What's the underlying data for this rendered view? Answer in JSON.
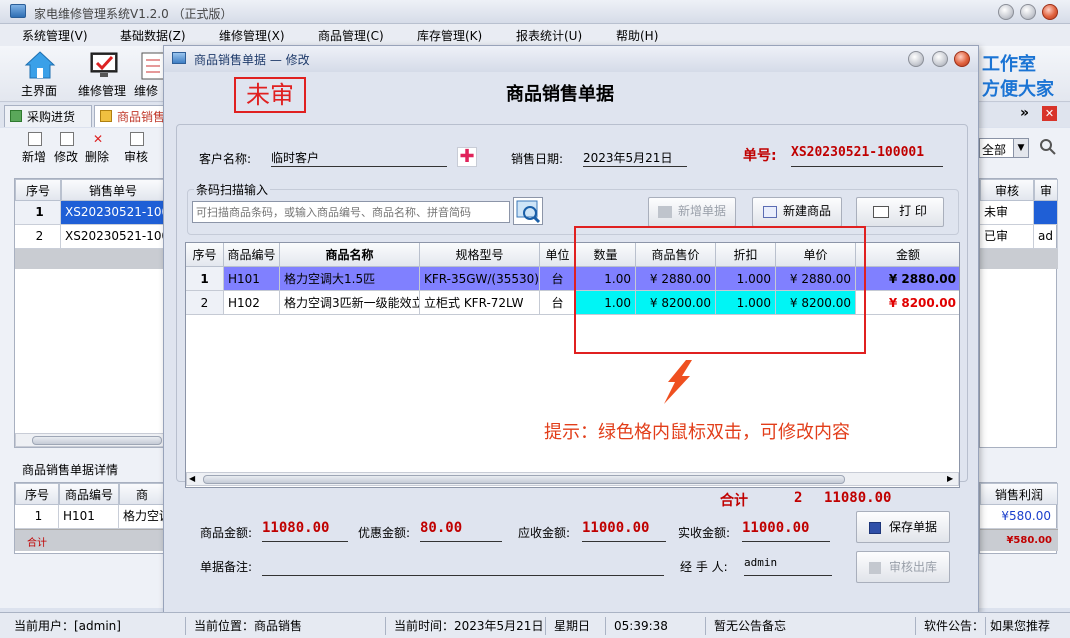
{
  "app": {
    "title": "家电维修管理系统V1.2.0 （正式版）"
  },
  "menu": [
    "系统管理(V)",
    "基础数据(Z)",
    "维修管理(X)",
    "商品管理(C)",
    "库存管理(K)",
    "报表统计(U)",
    "帮助(H)"
  ],
  "toolbar": {
    "home": "主界面",
    "repair": "维修管理",
    "repair2": "维修"
  },
  "banner": {
    "line1": "工作室",
    "line2": "方便大家"
  },
  "tabs": [
    {
      "label": "采购进货"
    },
    {
      "label": "商品销售"
    }
  ],
  "subtoolbar": {
    "add": "新增",
    "edit": "修改",
    "delete": "删除",
    "audit": "审核"
  },
  "right_filter": {
    "value": "全部"
  },
  "left_list": {
    "headers": [
      "序号",
      "销售单号"
    ],
    "rows": [
      {
        "no": "1",
        "id": "XS20230521-1000"
      },
      {
        "no": "2",
        "id": "XS20230521-1000"
      }
    ]
  },
  "right_cols": {
    "headers": [
      "审核",
      "审"
    ],
    "rows": [
      [
        "未审",
        ""
      ],
      [
        "已审",
        "ad"
      ]
    ]
  },
  "detail_panel": {
    "title": "商品销售单据详情",
    "headers": [
      "序号",
      "商品编号",
      "商"
    ],
    "rows": [
      {
        "no": "1",
        "code": "H101",
        "name": "格力空调"
      }
    ],
    "total_label": "合计",
    "profit_header": "销售利润",
    "profit_values": [
      "¥580.00"
    ],
    "profit_total": "¥580.00"
  },
  "dialog": {
    "title": "商品销售单据 — 修改",
    "stamp": "未审",
    "heading": "商品销售单据",
    "customer_label": "客户名称:",
    "customer_value": "临时客户",
    "date_label": "销售日期:",
    "date_value": "2023年5月21日",
    "order_label": "单号:",
    "order_no": "XS20230521-100001",
    "scan_group": "条码扫描输入",
    "scan_placeholder": "可扫描商品条码，或输入商品编号、商品名称、拼音简码",
    "btn_new_order": "新增单据",
    "btn_new_product": "新建商品",
    "btn_print": "打 印",
    "grid": {
      "headers": [
        "序号",
        "商品编号",
        "商品名称",
        "规格型号",
        "单位",
        "数量",
        "商品售价",
        "折扣",
        "单价",
        "金额"
      ],
      "rows": [
        [
          "1",
          "H101",
          "格力空调大1.5匹",
          "KFR-35GW/(35530)",
          "台",
          "1.00",
          "¥ 2880.00",
          "1.000",
          "¥ 2880.00",
          "¥ 2880.00"
        ],
        [
          "2",
          "H102",
          "格力空调3匹新一级能效立",
          "立柜式 KFR-72LW",
          "台",
          "1.00",
          "¥ 8200.00",
          "1.000",
          "¥ 8200.00",
          "¥ 8200.00"
        ]
      ]
    },
    "hint": "提示：绿色格内鼠标双击，可修改内容",
    "total_label": "合计",
    "total_count": "2",
    "total_amount": "11080.00",
    "goods_amount_label": "商品金额:",
    "goods_amount": "11080.00",
    "discount_label": "优惠金额:",
    "discount": "80.00",
    "receivable_label": "应收金额:",
    "receivable": "11000.00",
    "received_label": "实收金额:",
    "received": "11000.00",
    "remark_label": "单据备注:",
    "handler_label": "经 手 人:",
    "handler": "admin",
    "btn_save": "保存单据",
    "btn_audit": "审核出库"
  },
  "status": {
    "user": "当前用户：[admin]",
    "position": "当前位置：商品销售",
    "time": "当前时间：2023年5月21日",
    "weekday": "星期日",
    "clock": "05:39:38",
    "notice": "暂无公告备忘",
    "soft_notice": "软件公告：",
    "marquee": "如果您推荐"
  },
  "colors": {
    "accent_red": "#c00000",
    "selected_row": "#8080ff",
    "edit_cell": "#00f5f5",
    "highlight_box": "#e02020"
  }
}
